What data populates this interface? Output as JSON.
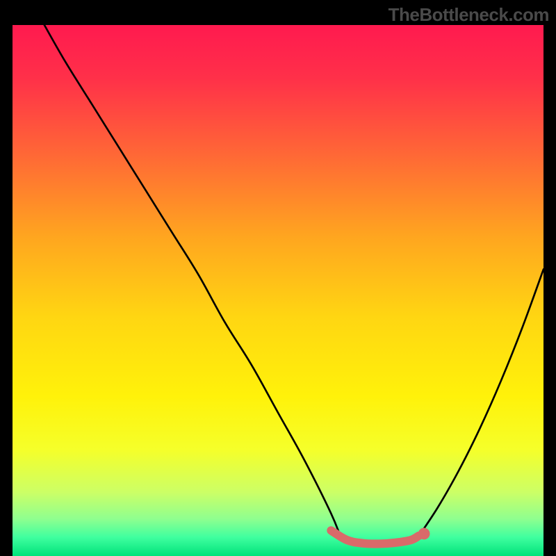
{
  "watermark": "TheBottleneck.com",
  "colors": {
    "bg": "#000000",
    "curve": "#000000",
    "accent": "#d96a6a",
    "gradient_stops": [
      {
        "offset": 0.0,
        "color": "#ff1a4f"
      },
      {
        "offset": 0.1,
        "color": "#ff3049"
      },
      {
        "offset": 0.25,
        "color": "#ff6a35"
      },
      {
        "offset": 0.4,
        "color": "#ffa61f"
      },
      {
        "offset": 0.55,
        "color": "#ffd612"
      },
      {
        "offset": 0.7,
        "color": "#fff20a"
      },
      {
        "offset": 0.8,
        "color": "#f5ff2a"
      },
      {
        "offset": 0.88,
        "color": "#ccff66"
      },
      {
        "offset": 0.93,
        "color": "#8fff8f"
      },
      {
        "offset": 0.965,
        "color": "#3fff9f"
      },
      {
        "offset": 1.0,
        "color": "#00e27a"
      }
    ]
  },
  "chart_data": {
    "type": "line",
    "title": "",
    "xlabel": "",
    "ylabel": "",
    "xlim": [
      0,
      100
    ],
    "ylim": [
      0,
      100
    ],
    "series": [
      {
        "name": "left-arm",
        "x": [
          6,
          10,
          15,
          20,
          25,
          30,
          35,
          40,
          45,
          50,
          55,
          60,
          62
        ],
        "values": [
          100,
          93,
          85,
          77,
          69,
          61,
          53,
          44,
          36,
          27,
          18,
          8,
          3
        ]
      },
      {
        "name": "right-arm",
        "x": [
          76,
          80,
          84,
          88,
          92,
          96,
          100
        ],
        "values": [
          3,
          9,
          16,
          24,
          33,
          43,
          54
        ]
      },
      {
        "name": "valley-floor",
        "x": [
          60,
          63,
          66,
          69,
          72,
          75,
          77
        ],
        "values": [
          4.5,
          2.6,
          2.1,
          2.0,
          2.2,
          2.8,
          4.0
        ]
      }
    ],
    "accent_segment": {
      "x": [
        60,
        63,
        66,
        69,
        72,
        75,
        76.5
      ],
      "values": [
        4.8,
        3.0,
        2.4,
        2.3,
        2.5,
        3.0,
        3.8
      ]
    },
    "accent_dot": {
      "x": 77.5,
      "y": 4.2
    }
  }
}
